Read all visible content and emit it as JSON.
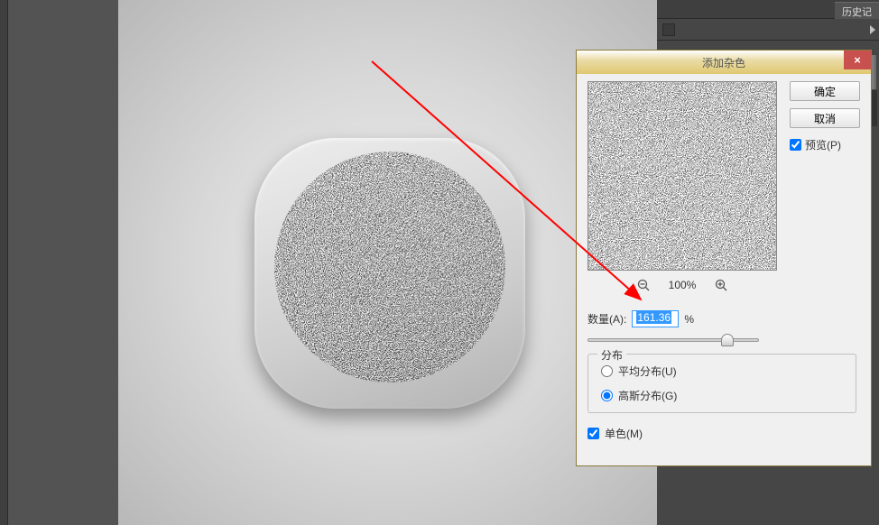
{
  "sidebar": {
    "history_tab": "历史记"
  },
  "dialog": {
    "title": "添加杂色",
    "close": "×",
    "ok_button": "确定",
    "cancel_button": "取消",
    "preview_checkbox": "预览(P)",
    "zoom_text": "100%",
    "amount_label": "数量(A):",
    "amount_value": "161.36",
    "amount_unit": "%",
    "distribution_legend": "分布",
    "uniform_label": "平均分布(U)",
    "gaussian_label": "高斯分布(G)",
    "monochrome_label": "单色(M)"
  }
}
